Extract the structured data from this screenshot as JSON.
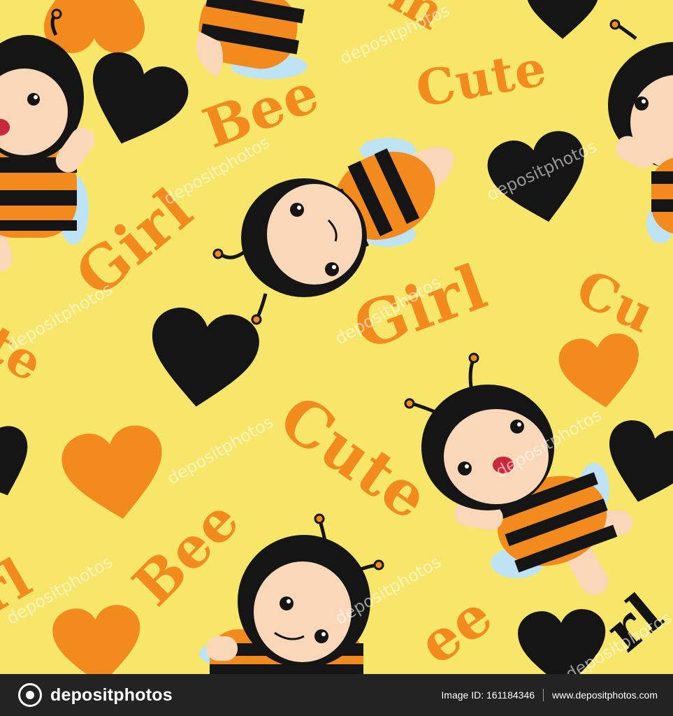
{
  "pattern": {
    "background_color": "#f7e66a",
    "colors": {
      "orange": "#f28a1e",
      "black": "#121212",
      "skin": "#f9d7b8"
    },
    "words": {
      "bee": "Bee",
      "cute": "Cute",
      "girl": "Girl",
      "bee_partial": "ee",
      "cute_partial": "te",
      "girl_partial": "rl",
      "cute_top_partial": "m",
      "cute_edge_partial": "Cu"
    },
    "watermark": "depositphotos"
  },
  "footer": {
    "brand_name": "depositphotos",
    "image_id_label": "Image ID: 161184346",
    "site_url": "www.depositphotos.com"
  }
}
